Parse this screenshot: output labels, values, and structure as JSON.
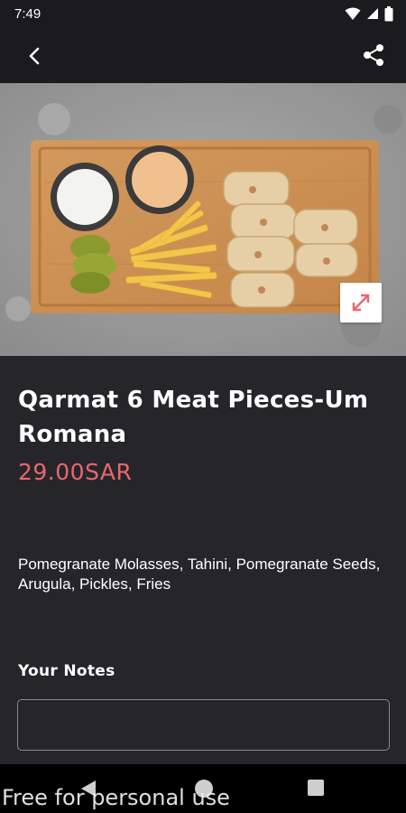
{
  "status_bar": {
    "time": "7:49",
    "icons": [
      "wifi-icon",
      "signal-icon",
      "battery-icon"
    ]
  },
  "app_bar": {
    "back_icon": "chevron-left-icon",
    "share_icon": "share-icon"
  },
  "hero": {
    "expand_icon": "expand-arrows-icon",
    "expand_icon_color": "#e8676d"
  },
  "product": {
    "title": "Qarmat 6 Meat Pieces-Um Romana",
    "price": "29.00SAR",
    "price_color": "#e8676d",
    "description": "Pomegranate Molasses, Tahini, Pomegranate Seeds, Arugula, Pickles, Fries"
  },
  "notes": {
    "label": "Your Notes",
    "value": ""
  },
  "nav_bar": {
    "icons": [
      "nav-back-icon",
      "nav-home-icon",
      "nav-recents-icon"
    ]
  },
  "watermark": "Free for personal use"
}
